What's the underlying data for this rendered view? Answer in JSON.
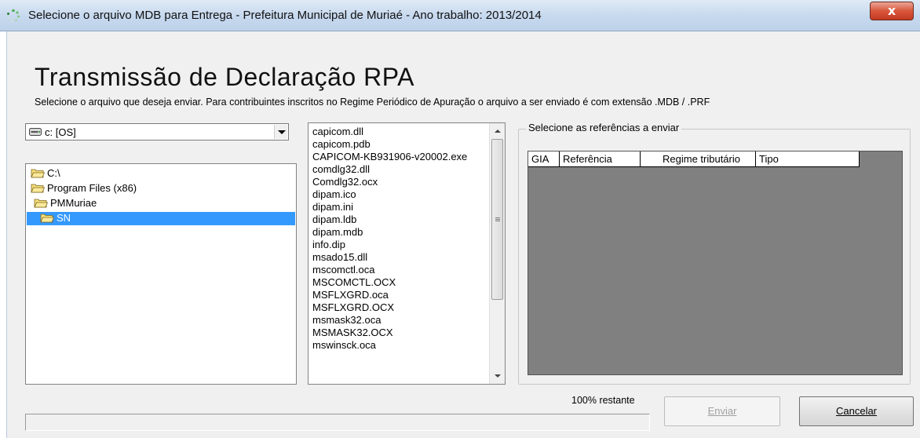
{
  "window": {
    "title": "Selecione o arquivo MDB para Entrega  - Prefeitura Municipal de Muriaé - Ano trabalho: 2013/2014",
    "close_label": "x"
  },
  "header": {
    "title": "Transmissão de Declaração RPA",
    "instructions": "Selecione o arquivo que deseja enviar. Para contribuintes inscritos no Regime Periódico de Apuração o arquivo a ser enviado é com extensão .MDB / .PRF"
  },
  "drive": {
    "selected": "c: [OS]"
  },
  "directories": [
    {
      "label": "C:\\",
      "selected": false
    },
    {
      "label": "Program Files (x86)",
      "selected": false
    },
    {
      "label": "PMMuriae",
      "selected": false
    },
    {
      "label": "SN",
      "selected": true
    }
  ],
  "files": [
    "capicom.dll",
    "capicom.pdb",
    "CAPICOM-KB931906-v20002.exe",
    "comdlg32.dll",
    "Comdlg32.ocx",
    "dipam.ico",
    "dipam.ini",
    "dipam.ldb",
    "dipam.mdb",
    "info.dip",
    "msado15.dll",
    "mscomctl.oca",
    "MSCOMCTL.OCX",
    "MSFLXGRD.oca",
    "MSFLXGRD.OCX",
    "msmask32.oca",
    "MSMASK32.OCX",
    "mswinsck.oca"
  ],
  "references": {
    "group_title": "Selecione as referências a enviar",
    "columns": [
      "GIA",
      "Referência",
      "Regime tributário",
      "Tipo"
    ]
  },
  "footer": {
    "remaining": "100% restante",
    "progress_percent": 0,
    "send_label": "Enviar",
    "cancel_label": "Cancelar"
  },
  "colors": {
    "selection": "#3399ff",
    "grid_background": "#808080",
    "dialog_background": "#f0f0f0"
  }
}
